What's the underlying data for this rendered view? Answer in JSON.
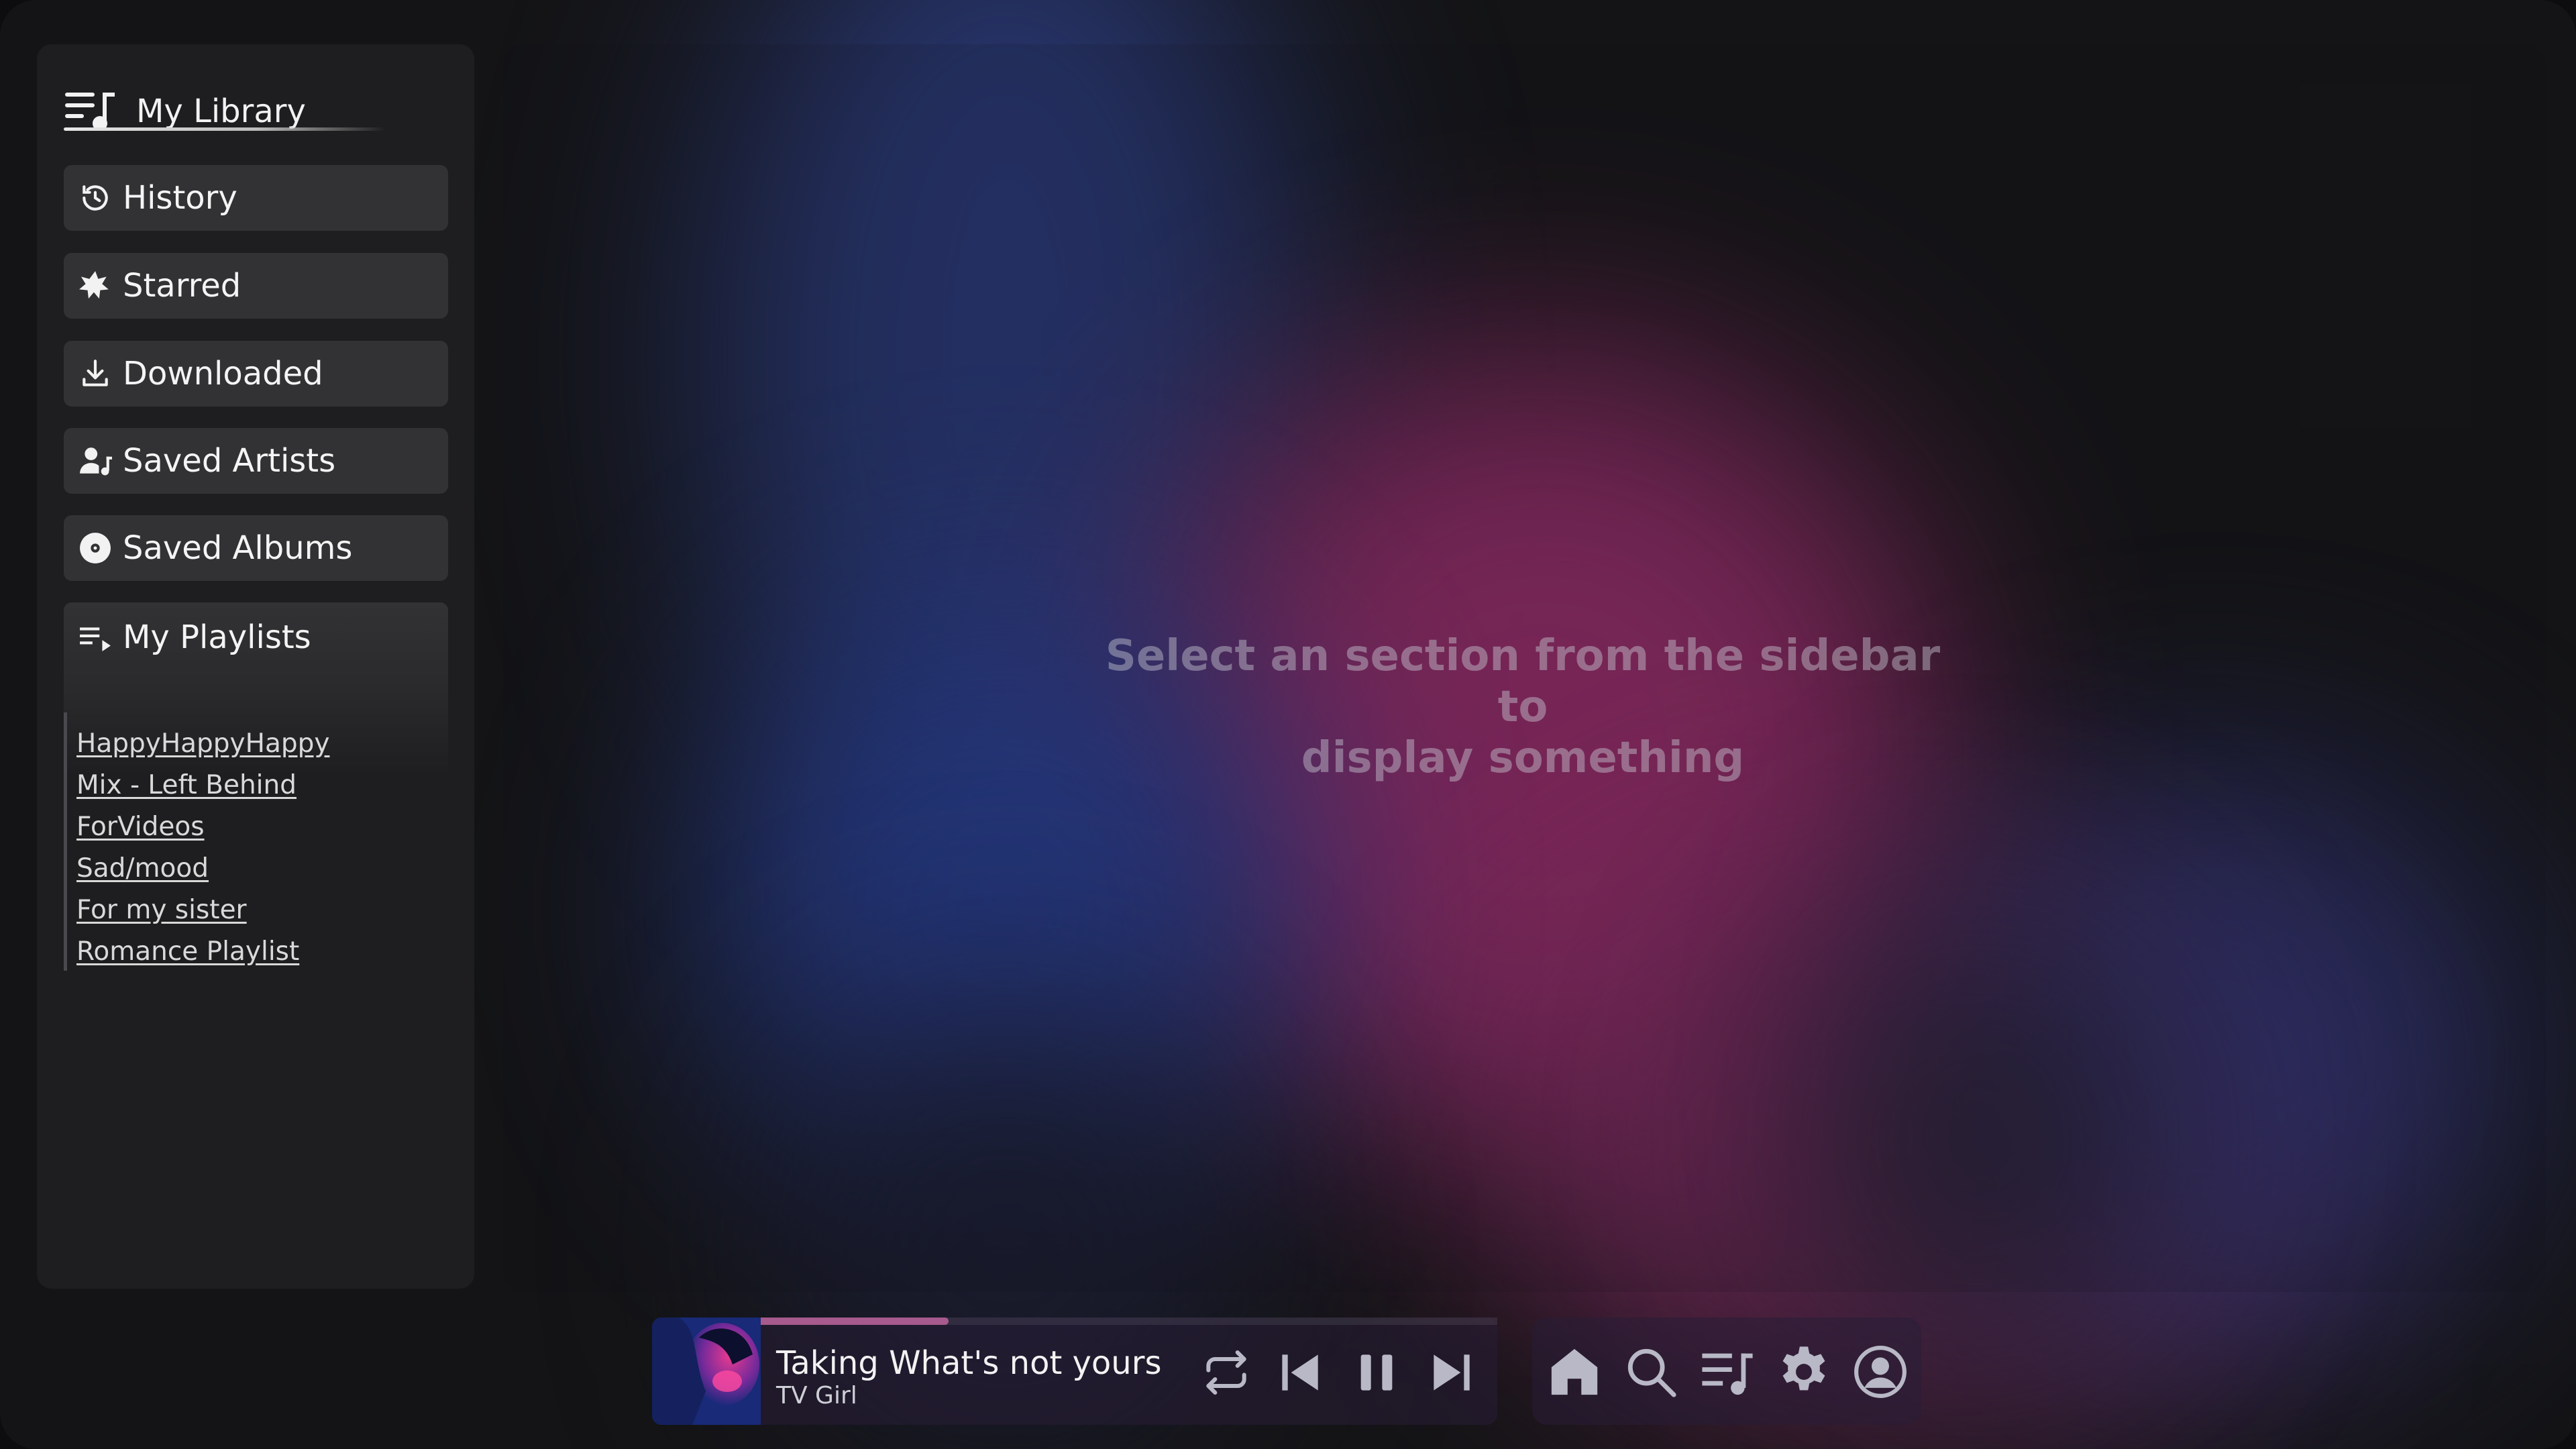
{
  "sidebar": {
    "title": "My Library",
    "items": [
      {
        "label": "History",
        "icon": "history-icon"
      },
      {
        "label": "Starred",
        "icon": "star-icon"
      },
      {
        "label": "Downloaded",
        "icon": "download-icon"
      },
      {
        "label": "Saved Artists",
        "icon": "artist-icon"
      },
      {
        "label": "Saved Albums",
        "icon": "album-icon"
      }
    ],
    "playlists": {
      "label": "My Playlists",
      "icon": "playlist-icon",
      "items": [
        "HappyHappyHappy",
        "Mix - Left Behind",
        "ForVideos",
        "Sad/mood",
        "For my sister",
        "Romance Playlist"
      ]
    }
  },
  "main": {
    "placeholder_line1": "Select an section from the sidebar to",
    "placeholder_line2": "display something"
  },
  "player": {
    "title": "Taking What's not yours",
    "artist": "TV Girl",
    "progress": 0.255,
    "controls": [
      "repeat-icon",
      "previous-icon",
      "pause-icon",
      "next-icon"
    ]
  },
  "navbar": {
    "icons": [
      "home-icon",
      "search-icon",
      "library-icon",
      "settings-icon",
      "profile-icon"
    ]
  },
  "colors": {
    "accent": "#a75a8d",
    "panel": "#1e1e20",
    "button": "#323234",
    "icon": "#b8b8c6"
  }
}
